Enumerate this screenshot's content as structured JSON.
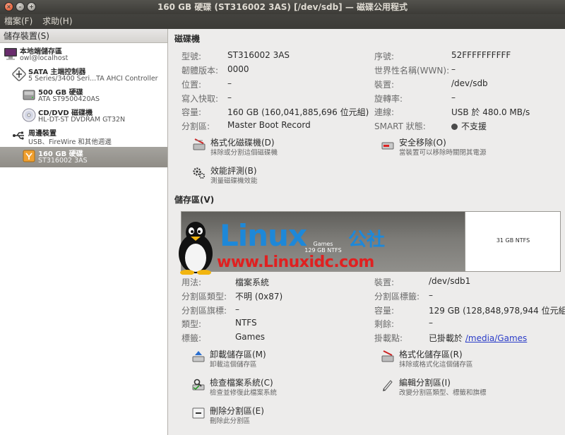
{
  "window": {
    "title": "160 GB 硬碟 (ST316002 3AS) [/dev/sdb] — 磁碟公用程式"
  },
  "menu": {
    "file": "檔案(F)",
    "help": "求助(H)"
  },
  "sidebar": {
    "header": "儲存裝置(S)",
    "items": [
      {
        "title": "本地端儲存區",
        "subtitle": "owl@localhost",
        "icon": "computer-icon"
      },
      {
        "title": "SATA 主端控制器",
        "subtitle": "5 Series/3400 Seri...TA AHCI Controller",
        "icon": "controller-icon"
      },
      {
        "title": "500 GB 硬碟",
        "subtitle": "ATA ST9500420AS",
        "icon": "harddisk-icon"
      },
      {
        "title": "CD/DVD 磁碟機",
        "subtitle": "HL-DT-ST DVDRAM GT32N",
        "icon": "optical-drive-icon"
      },
      {
        "title": "周邊裝置",
        "subtitle": "USB、FireWire 和其他週邊",
        "icon": "usb-icon"
      },
      {
        "title": "160 GB 硬碟",
        "subtitle": "ST316002 3AS",
        "icon": "usb-harddisk-icon",
        "selected": true
      }
    ]
  },
  "drive": {
    "section_title": "磁碟機",
    "fields": {
      "model_label": "型號:",
      "model": "ST316002 3AS",
      "firmware_label": "韌體版本:",
      "firmware": "0000",
      "location_label": "位置:",
      "location": "–",
      "write_cache_label": "寫入快取:",
      "write_cache": "–",
      "capacity_label": "容量:",
      "capacity": "160 GB (160,041,885,696 位元組)",
      "partitioning_label": "分割區:",
      "partitioning": "Master Boot Record",
      "serial_label": "序號:",
      "serial": "52FFFFFFFFFF",
      "wwn_label": "世界性名稱(WWN):",
      "wwn": "–",
      "device_label": "裝置:",
      "device": "/dev/sdb",
      "rotation_label": "旋轉率:",
      "rotation": "–",
      "connection_label": "連線:",
      "connection": "USB 於 480.0 MB/s",
      "smart_label": "SMART 狀態:",
      "smart": "不支援"
    },
    "actions": {
      "format_title": "格式化磁碟機(D)",
      "format_desc": "抹除或分割這個磁碟機",
      "eject_title": "安全移除(O)",
      "eject_desc": "當裝置可以移除時關閉其電源",
      "benchmark_title": "效能評測(B)",
      "benchmark_desc": "測量磁碟機效能"
    }
  },
  "volumes": {
    "section_title": "儲存區(V)",
    "vol1_line1": "Games",
    "vol1_line2": "129 GB NTFS",
    "vol2": "31 GB NTFS",
    "fields": {
      "usage_label": "用法:",
      "usage": "檔案系統",
      "part_type_label": "分割區類型:",
      "part_type": "不明 (0x87)",
      "part_flags_label": "分割區旗標:",
      "part_flags": "–",
      "type_label": "類型:",
      "type": "NTFS",
      "label_label": "標籤:",
      "label": "Games",
      "device_label": "裝置:",
      "device": "/dev/sdb1",
      "part_label_label": "分割區標籤:",
      "part_label": "–",
      "capacity_label": "容量:",
      "capacity": "129 GB (128,848,978,944 位元組)",
      "available_label": "剩餘:",
      "available": "–",
      "mount_label": "掛載點:",
      "mount_prefix": "已掛載於",
      "mount_path": "/media/Games"
    },
    "actions": {
      "unmount_title": "卸載儲存區(M)",
      "unmount_desc": "卸載這個儲存區",
      "format_title": "格式化儲存區(R)",
      "format_desc": "抹除或格式化這個儲存區",
      "check_title": "檢查檔案系統(C)",
      "check_desc": "檢查並修復此檔案系統",
      "edit_title": "編輯分割區(I)",
      "edit_desc": "改變分割區類型、標籤和旗標",
      "delete_title": "刪除分割區(E)",
      "delete_desc": "刪除此分割區"
    }
  },
  "watermark": {
    "brand": "Linux",
    "brand_cn": "公社",
    "url": "www.Linuxidc.com"
  }
}
